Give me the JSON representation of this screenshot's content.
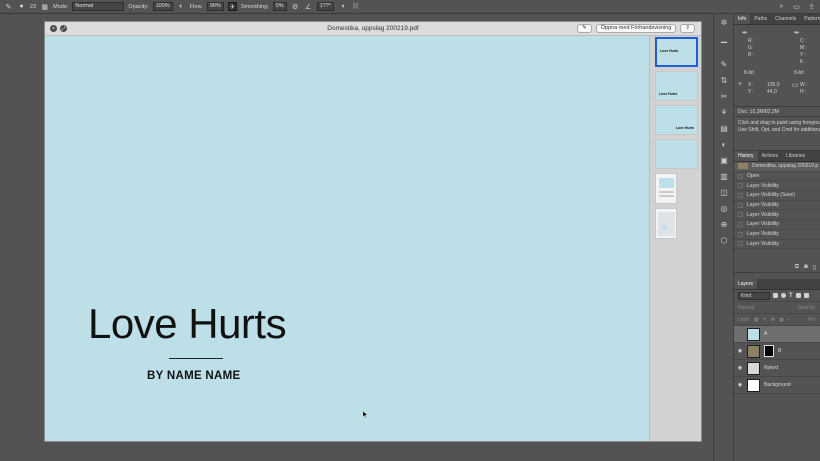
{
  "options_bar": {
    "mode_label": "Mode:",
    "mode_value": "Normal",
    "opacity_label": "Opacity:",
    "opacity_value": "100%",
    "flow_label": "Flow:",
    "flow_value": "90%",
    "smoothing_label": "Smoothing:",
    "smoothing_value": "0%",
    "angle_value": "1??°",
    "brush_size": "23"
  },
  "preview": {
    "document_title": "Domestika, uppslag 200219.pdf",
    "open_button": "Öppna med Förhandsvisning",
    "slide_title": "Love Hurts",
    "slide_subtitle": "BY NAME NAME",
    "thumbnails": [
      {
        "title": "Love Hurts",
        "selected": true
      },
      {
        "title": "Love Hurts",
        "selected": false
      },
      {
        "title": "Love Hurts",
        "selected": false
      },
      {
        "title": "",
        "selected": false
      }
    ]
  },
  "info_panel": {
    "tabs": [
      "Info",
      "Paths",
      "Channels",
      "Patterns"
    ],
    "r_label": "R :",
    "g_label": "G :",
    "b_label": "B :",
    "c_label": "C :",
    "m_label": "M :",
    "y_label": "Y :",
    "k_label": "K :",
    "bit_left": "8-bit",
    "bit_right": "8-bit",
    "x_label": "X :",
    "x_value": "105,0",
    "y_coord_label": "Y :",
    "y_value": "44,0",
    "w_label": "W :",
    "h_label": "H :",
    "doc_size": "Doc: 10,3M/82,2M",
    "hint_line1": "Click and drag to paint using foreground",
    "hint_line2": "Use Shift, Opt, and Cmd for additional op"
  },
  "history_panel": {
    "tabs": [
      "History",
      "Actions",
      "Libraries"
    ],
    "snapshot": "Domestika, uppslag 200219.p",
    "items": [
      "Open",
      "Layer Visibility",
      "Layer Visibility (Save)",
      "Layer Visibility",
      "Layer Visibility",
      "Layer Visibility",
      "Layer Visibility",
      "Layer Visibility"
    ]
  },
  "layers_panel": {
    "tab": "Layers",
    "filter_kind": "Kind",
    "blend_mode": "Normal",
    "opacity_label": "Opacity:",
    "lock_label": "Lock:",
    "fill_label": "Fill:",
    "layers": [
      {
        "name": "A",
        "visible": false,
        "selected": true
      },
      {
        "name": "B",
        "visible": true,
        "selected": false
      },
      {
        "name": "Nytext",
        "visible": true,
        "selected": false
      },
      {
        "name": "Background",
        "visible": true,
        "selected": false
      }
    ]
  },
  "colors": {
    "slide_bg": "#bde0e8",
    "selection": "#1f5fd6",
    "panel_bg": "#535353"
  }
}
